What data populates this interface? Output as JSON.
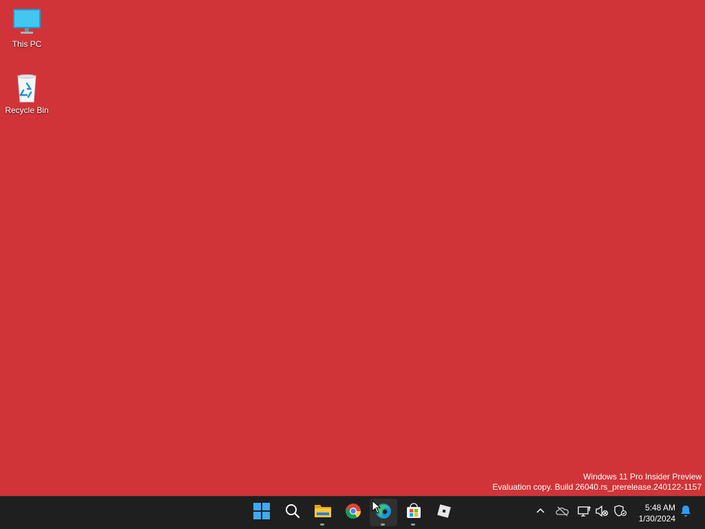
{
  "desktop": {
    "background_color": "#d13438",
    "icons": [
      {
        "label": "This PC",
        "icon": "monitor-icon"
      },
      {
        "label": "Recycle Bin",
        "icon": "recycle-bin-icon"
      }
    ]
  },
  "watermark": {
    "line1": "Windows 11 Pro Insider Preview",
    "line2": "Evaluation copy. Build 26040.rs_prerelease.240122-1157"
  },
  "taskbar": {
    "background_color": "#1f1f1f",
    "pinned": [
      {
        "name": "Start",
        "icon": "windows-start-icon",
        "running": false
      },
      {
        "name": "Search",
        "icon": "search-icon",
        "running": false
      },
      {
        "name": "File Explorer",
        "icon": "folder-icon",
        "running": true
      },
      {
        "name": "Google Chrome",
        "icon": "chrome-icon",
        "running": false
      },
      {
        "name": "Microsoft Edge",
        "icon": "edge-icon",
        "running": true,
        "active": true
      },
      {
        "name": "Microsoft Store",
        "icon": "store-icon",
        "running": true
      },
      {
        "name": "Roblox",
        "icon": "roblox-icon",
        "running": false
      }
    ],
    "tray": {
      "icons": [
        "chevron-up-icon",
        "onedrive-icon",
        "network-icon",
        "volume-muted-icon",
        "security-icon"
      ],
      "time": "5:48 AM",
      "date": "1/30/2024",
      "notification_icon": "bell-icon"
    }
  }
}
